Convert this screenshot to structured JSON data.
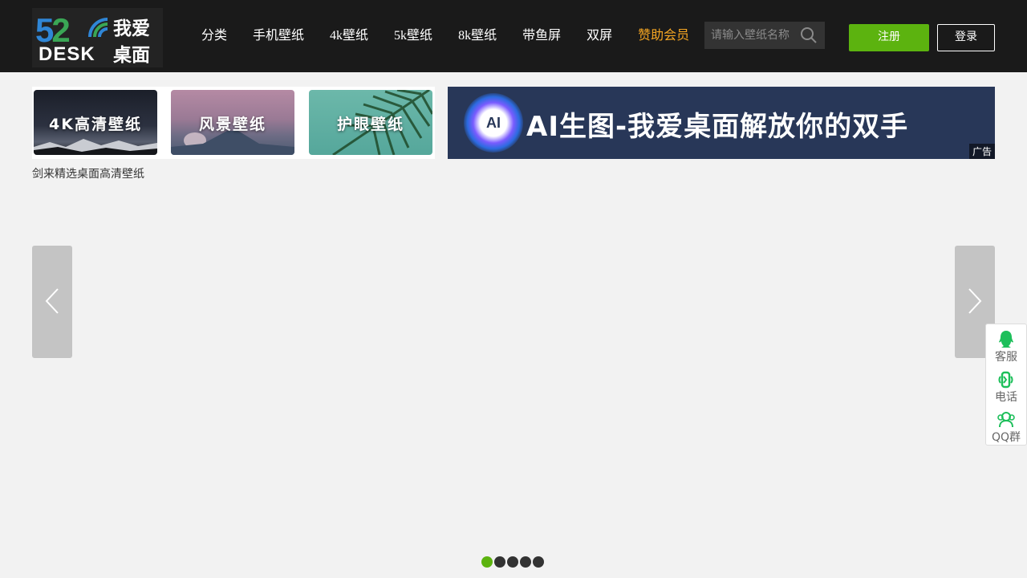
{
  "logo": {
    "num_5": "5",
    "num_2": "2",
    "desk": "DESK",
    "cn_top": "我爱",
    "cn_bottom": "桌面"
  },
  "nav": {
    "items": [
      "分类",
      "手机壁纸",
      "4k壁纸",
      "5k壁纸",
      "8k壁纸",
      "带鱼屏",
      "双屏",
      "赞助会员"
    ]
  },
  "search": {
    "placeholder": "请输入壁纸名称",
    "icon": "search-icon"
  },
  "auth": {
    "register": "注册",
    "login": "登录"
  },
  "categories": [
    {
      "label": "4K高清壁纸"
    },
    {
      "label": "风景壁纸"
    },
    {
      "label": "护眼壁纸"
    }
  ],
  "ad": {
    "orb_text": "AI",
    "text": "AI生图-我爱桌面解放你的双手",
    "tag": "广告"
  },
  "slider": {
    "image_alt": "剑来精选桌面高清壁纸",
    "dot_count": 5,
    "active_dot": 1
  },
  "side_panel": {
    "items": [
      {
        "label": "客服",
        "icon": "qq-penguin-icon"
      },
      {
        "label": "电话",
        "icon": "phone-icon"
      },
      {
        "label": "QQ群",
        "icon": "qq-group-icon"
      }
    ]
  },
  "colors": {
    "header_bg": "#1a1a1a",
    "accent_green": "#5cb30f",
    "vip_orange": "#f5a623",
    "page_bg": "#f2f2f2",
    "side_icon_green": "#1dbf5a"
  }
}
